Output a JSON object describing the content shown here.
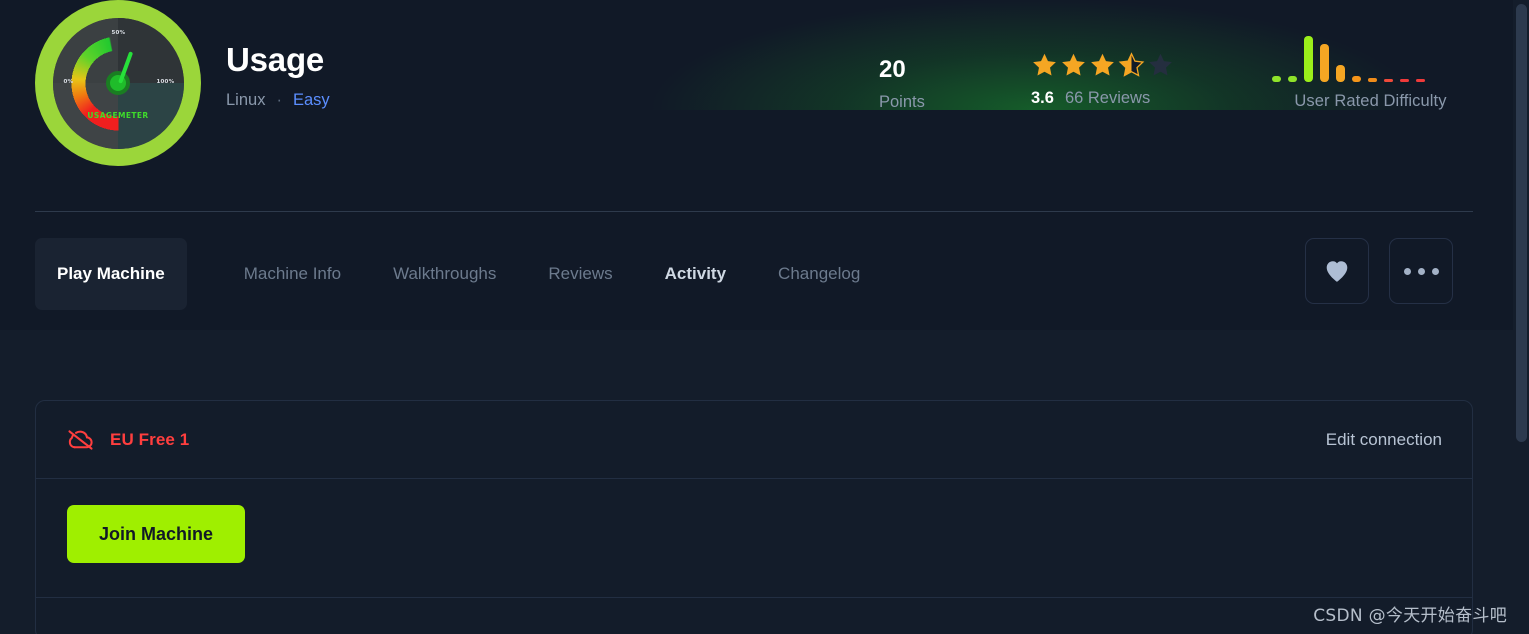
{
  "machine": {
    "name": "Usage",
    "os": "Linux",
    "separator": "·",
    "difficulty": "Easy",
    "avatar": {
      "icon_name": "gauge-meter-icon",
      "word": "USAGEMETER",
      "tick_min": "0%",
      "tick_mid": "50%",
      "tick_max": "100%"
    }
  },
  "stats": {
    "points_value": "20",
    "points_label": "Points",
    "rating_value": "3.6",
    "rating_stars": 3.5,
    "reviews_label": "66 Reviews",
    "difficulty_chart_label": "User Rated Difficulty"
  },
  "chart_data": {
    "type": "bar",
    "title": "User Rated Difficulty",
    "categories": [
      "1",
      "2",
      "3",
      "4",
      "5",
      "6",
      "7",
      "8",
      "9",
      "10"
    ],
    "values": [
      6,
      6,
      46,
      38,
      17,
      6,
      4,
      3,
      3,
      3
    ],
    "colors": [
      "#8fe32a",
      "#8fe32a",
      "#9bef1a",
      "#f5a623",
      "#f5a623",
      "#f5951a",
      "#f08c1a",
      "#f04a3a",
      "#f03a3a",
      "#f03a3a"
    ],
    "xlabel": "",
    "ylabel": "",
    "ylim": [
      0,
      46
    ],
    "grid": false,
    "legend": false
  },
  "tabs": [
    {
      "label": "Play Machine",
      "active": true,
      "style": "boxed"
    },
    {
      "label": "Machine Info",
      "active": false,
      "style": "plain"
    },
    {
      "label": "Walkthroughs",
      "active": false,
      "style": "plain"
    },
    {
      "label": "Reviews",
      "active": false,
      "style": "plain"
    },
    {
      "label": "Activity",
      "active": false,
      "style": "highlight"
    },
    {
      "label": "Changelog",
      "active": false,
      "style": "plain"
    }
  ],
  "header_actions": {
    "favorite_icon": "heart-icon",
    "more_icon": "ellipsis-icon"
  },
  "connection": {
    "status_icon": "cloud-off-icon",
    "server_name": "EU Free 1",
    "edit_label": "Edit connection",
    "join_label": "Join Machine"
  },
  "colors": {
    "accent_green": "#9fef00",
    "danger_red": "#ff3e3e",
    "link_blue": "#5b8eff",
    "star_gold": "#f5a623",
    "page_bg": "#141d2b",
    "header_bg": "#111927"
  },
  "watermark": {
    "text": "CSDN @今天开始奋斗吧"
  }
}
